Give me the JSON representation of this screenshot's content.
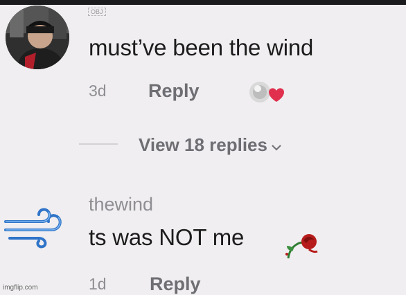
{
  "comment1": {
    "badge": "OBJ",
    "text": "must’ve been the wind",
    "age": "3d",
    "reply_label": "Reply",
    "view_replies_label": "View 18 replies"
  },
  "comment2": {
    "username": "thewind",
    "text": "ts was NOT me",
    "age": "1d",
    "reply_label": "Reply"
  },
  "watermark": "imgflip.com",
  "colors": {
    "background": "#f0eef0",
    "primary_text": "#1c1c1c",
    "secondary_text": "#8e8e93",
    "heart": "#e0304e"
  },
  "icons": {
    "like": "heart-icon",
    "chevron": "chevron-down-icon",
    "avatar2": "wind-icon",
    "emoji": "wilted-rose-icon"
  }
}
